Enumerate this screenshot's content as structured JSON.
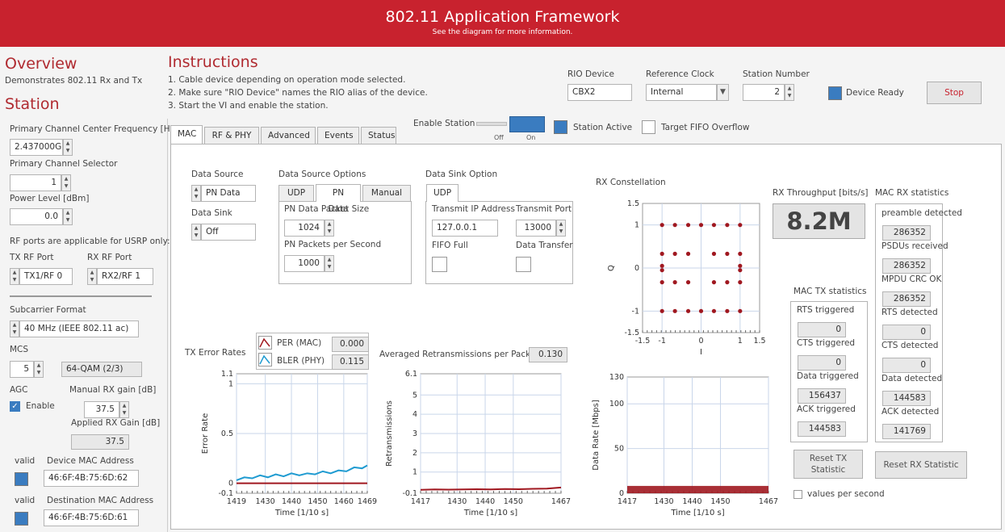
{
  "banner": {
    "title": "802.11 Application Framework",
    "subtitle": "See the diagram for more information."
  },
  "overview": {
    "title": "Overview",
    "desc": "Demonstrates 802.11 Rx and Tx"
  },
  "station_title": "Station",
  "instructions": {
    "title": "Instructions",
    "steps": [
      "1. Cable device depending on operation mode selected.",
      "2. Make sure \"RIO Device\" names the RIO alias of the device.",
      "3. Start the VI and enable the station."
    ]
  },
  "top": {
    "rio_label": "RIO Device",
    "rio_value": "CBX2",
    "ref_label": "Reference Clock",
    "ref_value": "Internal",
    "station_label": "Station Number",
    "station_value": "2",
    "device_ready": "Device Ready",
    "stop": "Stop"
  },
  "left": {
    "freq_label": "Primary Channel Center Frequency [Hz]",
    "freq_value": "2.437000G",
    "selector_label": "Primary Channel Selector",
    "selector_value": "1",
    "power_label": "Power Level [dBm]",
    "power_value": "0.0",
    "rf_note": "RF ports are applicable for USRP only:",
    "tx_port_label": "TX RF Port",
    "tx_port_value": "TX1/RF 0",
    "rx_port_label": "RX RF Port",
    "rx_port_value": "RX2/RF 1",
    "subcarrier_label": "Subcarrier Format",
    "subcarrier_value": "40 MHz (IEEE 802.11 ac)",
    "mcs_label": "MCS",
    "mcs_value": "5",
    "mcs_desc": "64-QAM (2/3)",
    "agc_label": "AGC",
    "agc_enable": "Enable",
    "manual_gain_label": "Manual RX gain [dB]",
    "manual_gain_value": "37.5",
    "applied_gain_label": "Applied RX Gain [dB]",
    "applied_gain_value": "37.5",
    "valid1": "valid",
    "dev_mac_label": "Device MAC Address",
    "dev_mac_value": "46:6F:4B:75:6D:62",
    "valid2": "valid",
    "dst_mac_label": "Destination MAC Address",
    "dst_mac_value": "46:6F:4B:75:6D:61"
  },
  "station_bar": {
    "enable_label": "Enable Station",
    "off": "Off",
    "on": "On",
    "active": "Station Active",
    "overflow": "Target FIFO Overflow"
  },
  "tabs": [
    "MAC",
    "RF & PHY",
    "Advanced",
    "Events",
    "Status"
  ],
  "mac": {
    "data_source_label": "Data Source",
    "data_source_value": "PN Data",
    "data_sink_label": "Data Sink",
    "data_sink_value": "Off",
    "dso_label": "Data Source Options",
    "dso_tabs": [
      "UDP",
      "PN Data",
      "Manual"
    ],
    "pn_size_label": "PN Data Packet Size",
    "pn_size_value": "1024",
    "pn_rate_label": "PN Packets per Second",
    "pn_rate_value": "1000",
    "dsink_label": "Data Sink Option",
    "dsink_tab": "UDP",
    "tx_ip_label": "Transmit IP Address",
    "tx_ip_value": "127.0.0.1",
    "tx_port_label": "Transmit Port",
    "tx_port_value": "13000",
    "fifo_full": "FIFO Full",
    "data_transfer": "Data Transfer"
  },
  "tx_err": {
    "title": "TX Error Rates",
    "per_label": "PER (MAC)",
    "per_value": "0.000",
    "bler_label": "BLER (PHY)",
    "bler_value": "0.115",
    "ylabel": "Error Rate",
    "xlabel": "Time [1/10 s]"
  },
  "retx": {
    "title": "Averaged Retransmissions per Packet",
    "value": "0.130",
    "ylabel": "Retransmissions",
    "xlabel": "Time [1/10 s]"
  },
  "const": {
    "title": "RX Constellation",
    "ylabel": "Q",
    "xlabel": "I"
  },
  "rate": {
    "ylabel": "Data Rate [Mbps]",
    "xlabel": "Time [1/10 s]"
  },
  "throughput": {
    "label": "RX Throughput [bits/s]",
    "value": "8.2M"
  },
  "mac_tx": {
    "title": "MAC TX statistics",
    "items": [
      {
        "label": "RTS triggered",
        "value": "0"
      },
      {
        "label": "CTS triggered",
        "value": "0"
      },
      {
        "label": "Data triggered",
        "value": "156437"
      },
      {
        "label": "ACK triggered",
        "value": "144583"
      }
    ]
  },
  "mac_rx": {
    "title": "MAC RX statistics",
    "items": [
      {
        "label": "preamble detected",
        "value": "286352"
      },
      {
        "label": "PSDUs received",
        "value": "286352"
      },
      {
        "label": "MPDU CRC OK",
        "value": "286352"
      },
      {
        "label": "RTS detected",
        "value": "0"
      },
      {
        "label": "CTS detected",
        "value": "0"
      },
      {
        "label": "Data detected",
        "value": "144583"
      },
      {
        "label": "ACK detected",
        "value": "141769"
      }
    ]
  },
  "reset_tx": "Reset TX Statistic",
  "reset_rx": "Reset RX Statistic",
  "values_per_second": "values per second",
  "colors": {
    "accent": "#c8222e",
    "led": "#3a7cc0",
    "series_red": "#a01820",
    "series_blue": "#1f9bd1"
  },
  "chart_data": [
    {
      "type": "line",
      "title": "TX Error Rates",
      "xlabel": "Time [1/10 s]",
      "ylabel": "Error Rate",
      "xlim": [
        1419,
        1469
      ],
      "ylim": [
        -0.1,
        1.1
      ],
      "x_ticks": [
        1419,
        1430,
        1440,
        1450,
        1460,
        1469
      ],
      "y_ticks": [
        -0.1,
        0,
        0.5,
        1,
        1.1
      ],
      "series": [
        {
          "name": "PER (MAC)",
          "x": [
            1419,
            1469
          ],
          "values": [
            0,
            0
          ]
        },
        {
          "name": "BLER (PHY)",
          "x": [
            1419,
            1422,
            1425,
            1428,
            1431,
            1434,
            1437,
            1440,
            1443,
            1446,
            1449,
            1452,
            1455,
            1458,
            1461,
            1464,
            1467,
            1469
          ],
          "values": [
            0.03,
            0.06,
            0.05,
            0.08,
            0.06,
            0.09,
            0.07,
            0.1,
            0.08,
            0.1,
            0.09,
            0.12,
            0.1,
            0.13,
            0.12,
            0.16,
            0.15,
            0.18
          ]
        }
      ]
    },
    {
      "type": "line",
      "title": "Averaged Retransmissions per Packet",
      "xlabel": "Time [1/10 s]",
      "ylabel": "Retransmissions",
      "xlim": [
        1417,
        1467
      ],
      "ylim": [
        -0.1,
        6.1
      ],
      "x_ticks": [
        1417,
        1430,
        1440,
        1450,
        1467
      ],
      "y_ticks": [
        -0.1,
        1,
        2,
        3,
        4,
        5,
        6.1
      ],
      "series": [
        {
          "x": [
            1417,
            1422,
            1427,
            1432,
            1437,
            1442,
            1447,
            1452,
            1457,
            1462,
            1467
          ],
          "values": [
            0.08,
            0.1,
            0.09,
            0.1,
            0.11,
            0.1,
            0.12,
            0.11,
            0.13,
            0.14,
            0.2
          ]
        }
      ]
    },
    {
      "type": "scatter",
      "title": "RX Constellation",
      "xlabel": "I",
      "ylabel": "Q",
      "xlim": [
        -1.5,
        1.5
      ],
      "ylim": [
        -1.5,
        1.5
      ],
      "x_ticks": [
        -1.5,
        -1,
        0,
        1,
        1.5
      ],
      "y_ticks": [
        -1.5,
        -1,
        0,
        1,
        1.5
      ],
      "points": [
        [
          -1,
          1
        ],
        [
          -0.67,
          1
        ],
        [
          -0.33,
          1
        ],
        [
          0,
          1
        ],
        [
          0.33,
          1
        ],
        [
          0.67,
          1
        ],
        [
          1,
          1
        ],
        [
          -1,
          0.33
        ],
        [
          -0.67,
          0.33
        ],
        [
          -0.33,
          0.33
        ],
        [
          0.33,
          0.33
        ],
        [
          0.67,
          0.33
        ],
        [
          1,
          0.33
        ],
        [
          -1,
          0.05
        ],
        [
          -1,
          -0.05
        ],
        [
          1,
          0.05
        ],
        [
          1,
          -0.05
        ],
        [
          -1,
          -0.33
        ],
        [
          -0.67,
          -0.33
        ],
        [
          -0.33,
          -0.33
        ],
        [
          0.33,
          -0.33
        ],
        [
          0.67,
          -0.33
        ],
        [
          1,
          -0.33
        ],
        [
          -1,
          -1
        ],
        [
          -0.67,
          -1
        ],
        [
          -0.33,
          -1
        ],
        [
          0,
          -1
        ],
        [
          0.33,
          -1
        ],
        [
          0.67,
          -1
        ],
        [
          1,
          -1
        ]
      ]
    },
    {
      "type": "area",
      "title": "",
      "xlabel": "Time [1/10 s]",
      "ylabel": "Data Rate [Mbps]",
      "xlim": [
        1417,
        1467
      ],
      "ylim": [
        0,
        130
      ],
      "x_ticks": [
        1417,
        1430,
        1440,
        1450,
        1467
      ],
      "y_ticks": [
        0,
        50,
        100,
        130
      ],
      "series": [
        {
          "x": [
            1417,
            1467
          ],
          "values": [
            8.2,
            8.2
          ]
        }
      ]
    }
  ]
}
